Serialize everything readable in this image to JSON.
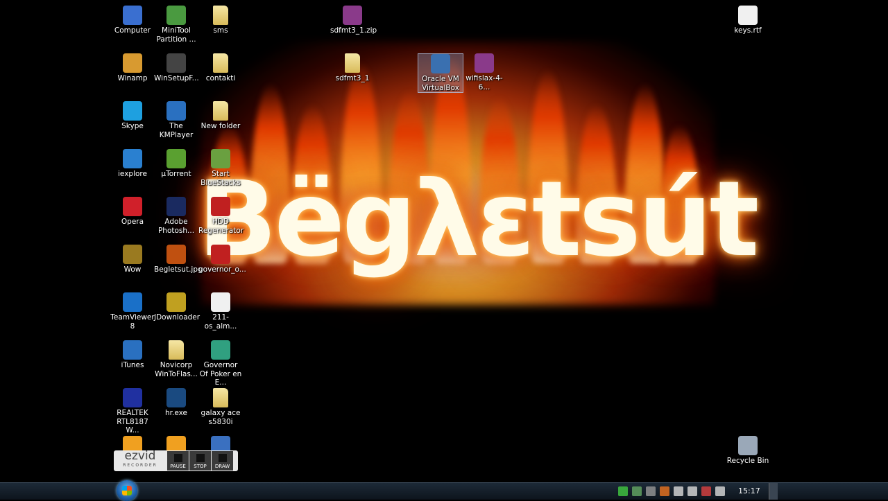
{
  "wallpaper": {
    "text": "Bëgλεtsút"
  },
  "desktop_icons": [
    {
      "label": "Computer",
      "icon": "computer-icon",
      "color": "#3a6fd0"
    },
    {
      "label": "MiniTool Partition ...",
      "icon": "minitool-icon",
      "color": "#4a9a40"
    },
    {
      "label": "sms",
      "icon": "folder-icon",
      "color": "#e8d080"
    },
    {
      "label": "Winamp",
      "icon": "winamp-icon",
      "color": "#d89a30"
    },
    {
      "label": "WinSetupF...",
      "icon": "usb-icon",
      "color": "#444444"
    },
    {
      "label": "contakti",
      "icon": "folder-icon",
      "color": "#e8d080"
    },
    {
      "label": "Skype",
      "icon": "skype-icon",
      "color": "#1ea0e0"
    },
    {
      "label": "The KMPlayer",
      "icon": "kmplayer-icon",
      "color": "#2a70c0"
    },
    {
      "label": "New folder",
      "icon": "folder-icon",
      "color": "#e8d080"
    },
    {
      "label": "iexplore",
      "icon": "internet-explorer-icon",
      "color": "#2a80d0"
    },
    {
      "label": "µTorrent",
      "icon": "utorrent-icon",
      "color": "#5aa030"
    },
    {
      "label": "Start BlueStacks",
      "icon": "bluestacks-icon",
      "color": "#6aa040"
    },
    {
      "label": "Opera",
      "icon": "opera-icon",
      "color": "#d0202a"
    },
    {
      "label": "Adobe Photosh...",
      "icon": "photoshop-icon",
      "color": "#1a2a60"
    },
    {
      "label": "HDD Regenerator",
      "icon": "hdd-regenerator-icon",
      "color": "#c02020"
    },
    {
      "label": "Wow",
      "icon": "wow-icon",
      "color": "#9a7a20"
    },
    {
      "label": "Begletsut.jpg",
      "icon": "image-file-icon",
      "color": "#c05010"
    },
    {
      "label": "governor_o...",
      "icon": "image-file-icon",
      "color": "#c02020"
    },
    {
      "label": "TeamViewer 8",
      "icon": "teamviewer-icon",
      "color": "#1a70c8"
    },
    {
      "label": "JDownloader",
      "icon": "jdownloader-icon",
      "color": "#c0a020"
    },
    {
      "label": "211-os_alm...",
      "icon": "mp3-file-icon",
      "color": "#f0f0f0"
    },
    {
      "label": "iTunes",
      "icon": "itunes-icon",
      "color": "#2a70c0"
    },
    {
      "label": "Novicorp WinToFlas...",
      "icon": "folder-icon",
      "color": "#e8d080"
    },
    {
      "label": "Governor Of Poker en E...",
      "icon": "poker-icon",
      "color": "#30a080"
    },
    {
      "label": "REALTEK RTL8187 W...",
      "icon": "realtek-icon",
      "color": "#2030a0"
    },
    {
      "label": "hr.exe",
      "icon": "hr-exe-icon",
      "color": "#1a4a80"
    },
    {
      "label": "galaxy ace s5830i",
      "icon": "folder-icon",
      "color": "#e8d080"
    },
    {
      "label": "",
      "icon": "media-player-icon",
      "color": "#f0a020"
    },
    {
      "label": "",
      "icon": "media-player-icon",
      "color": "#f0a020"
    },
    {
      "label": "",
      "icon": "application-icon",
      "color": "#3a70c0"
    },
    {
      "label": "sdfmt3_1.zip",
      "icon": "winrar-archive-icon",
      "color": "#8a3a8a"
    },
    {
      "label": "sdfmt3_1",
      "icon": "folder-icon",
      "color": "#e8d080"
    },
    {
      "label": "Oracle VM VirtualBox",
      "icon": "virtualbox-icon",
      "color": "#3a70b0",
      "selected": true
    },
    {
      "label": "wifislax-4-6...",
      "icon": "winrar-archive-icon",
      "color": "#8a3a8a"
    },
    {
      "label": "keys.rtf",
      "icon": "document-icon",
      "color": "#f0f0f0"
    },
    {
      "label": "Recycle Bin",
      "icon": "recycle-bin-icon",
      "color": "#9aa8b8"
    }
  ],
  "ezvid": {
    "logo": "ezvid",
    "sub": "RECORDER",
    "pause": "PAUSE",
    "stop": "STOP",
    "draw": "DRAW"
  },
  "taskbar": {
    "clock": "15:17",
    "tray_icons": [
      {
        "icon": "signal-bars-icon",
        "color": "#40c040"
      },
      {
        "icon": "security-shield-icon",
        "color": "#60a060"
      },
      {
        "icon": "monitor-icon",
        "color": "#909090"
      },
      {
        "icon": "avast-icon",
        "color": "#e07020"
      },
      {
        "icon": "network-adapter-icon",
        "color": "#d0d0d0"
      },
      {
        "icon": "wifi-strength-icon",
        "color": "#d0d0d0"
      },
      {
        "icon": "volume-muted-icon",
        "color": "#d04040"
      },
      {
        "icon": "action-center-flag-icon",
        "color": "#d0d0d0"
      }
    ]
  }
}
